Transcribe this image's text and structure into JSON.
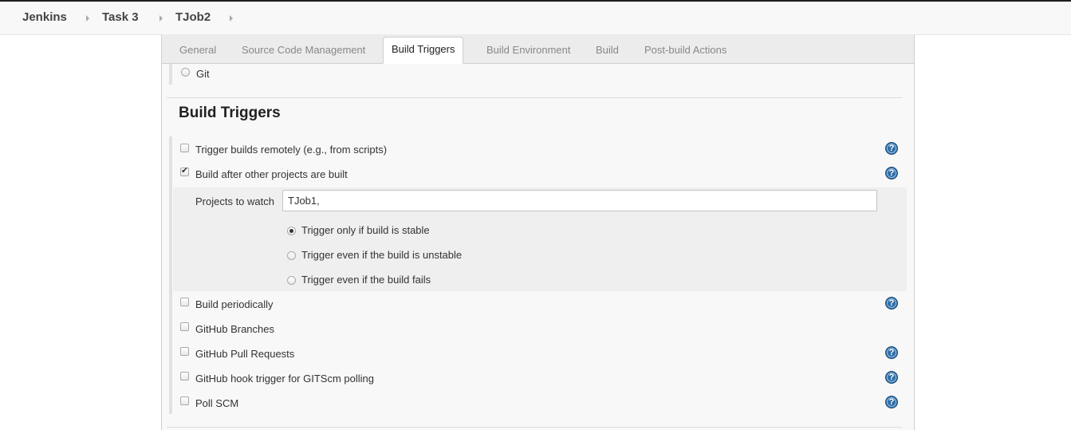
{
  "breadcrumb": {
    "items": [
      "Jenkins",
      "Task 3",
      "TJob2"
    ]
  },
  "tabs": [
    "General",
    "Source Code Management",
    "Build Triggers",
    "Build Environment",
    "Build",
    "Post-build Actions"
  ],
  "active_tab": "Build Triggers",
  "scm": {
    "git_label": "Git"
  },
  "build_triggers": {
    "title": "Build Triggers",
    "trigger_remotely": {
      "label": "Trigger builds remotely (e.g., from scripts)",
      "checked": false
    },
    "build_after_other": {
      "label": "Build after other projects are built",
      "checked": true
    },
    "projects_to_watch": {
      "label": "Projects to watch",
      "value": "TJob1,"
    },
    "trigger_options": [
      {
        "label": "Trigger only if build is stable",
        "selected": true
      },
      {
        "label": "Trigger even if the build is unstable",
        "selected": false
      },
      {
        "label": "Trigger even if the build fails",
        "selected": false
      }
    ],
    "build_periodically": {
      "label": "Build periodically",
      "checked": false
    },
    "github_branches": {
      "label": "GitHub Branches",
      "checked": false
    },
    "github_pull_requests": {
      "label": "GitHub Pull Requests",
      "checked": false
    },
    "github_hook_trigger": {
      "label": "GitHub hook trigger for GITScm polling",
      "checked": false
    },
    "poll_scm": {
      "label": "Poll SCM",
      "checked": false
    }
  },
  "help_icon_glyph": "?",
  "colors": {
    "accent_help": "#2f6ea7",
    "tab_bar": "#ececec",
    "panel_bg": "#f8f8f8"
  }
}
